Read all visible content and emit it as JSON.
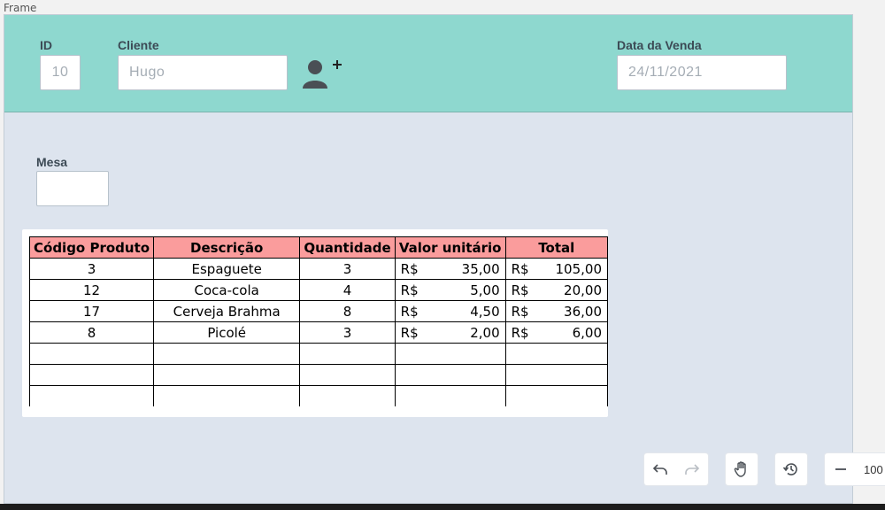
{
  "frame_label": "Frame",
  "form": {
    "id_label": "ID",
    "id_value": "10",
    "cliente_label": "Cliente",
    "cliente_value": "Hugo",
    "data_label": "Data da Venda",
    "data_value": "24/11/2021",
    "mesa_label": "Mesa",
    "mesa_value": "",
    "add_user_icon": "add-user-icon"
  },
  "table": {
    "headers": [
      "Código Produto",
      "Descrição",
      "Quantidade",
      "Valor unitário",
      "Total"
    ],
    "currency": "R$",
    "rows": [
      {
        "codigo": "3",
        "descricao": "Espaguete",
        "quantidade": "3",
        "valor": "35,00",
        "total": "105,00"
      },
      {
        "codigo": "12",
        "descricao": "Coca-cola",
        "quantidade": "4",
        "valor": "5,00",
        "total": "20,00"
      },
      {
        "codigo": "17",
        "descricao": "Cerveja Brahma",
        "quantidade": "8",
        "valor": "4,50",
        "total": "36,00"
      },
      {
        "codigo": "8",
        "descricao": "Picolé",
        "quantidade": "3",
        "valor": "2,00",
        "total": "6,00"
      }
    ],
    "empty_rows": 3
  },
  "toolbar": {
    "undo_icon": "undo-icon",
    "redo_icon": "redo-icon",
    "hand_icon": "hand-icon",
    "history_icon": "history-icon",
    "zoom_out_icon": "minus-icon",
    "zoom_text": "100"
  },
  "colors": {
    "header_bg": "#8ed8cf",
    "canvas_bg": "#dde4ee",
    "table_header_bg": "#fa9c9c"
  }
}
